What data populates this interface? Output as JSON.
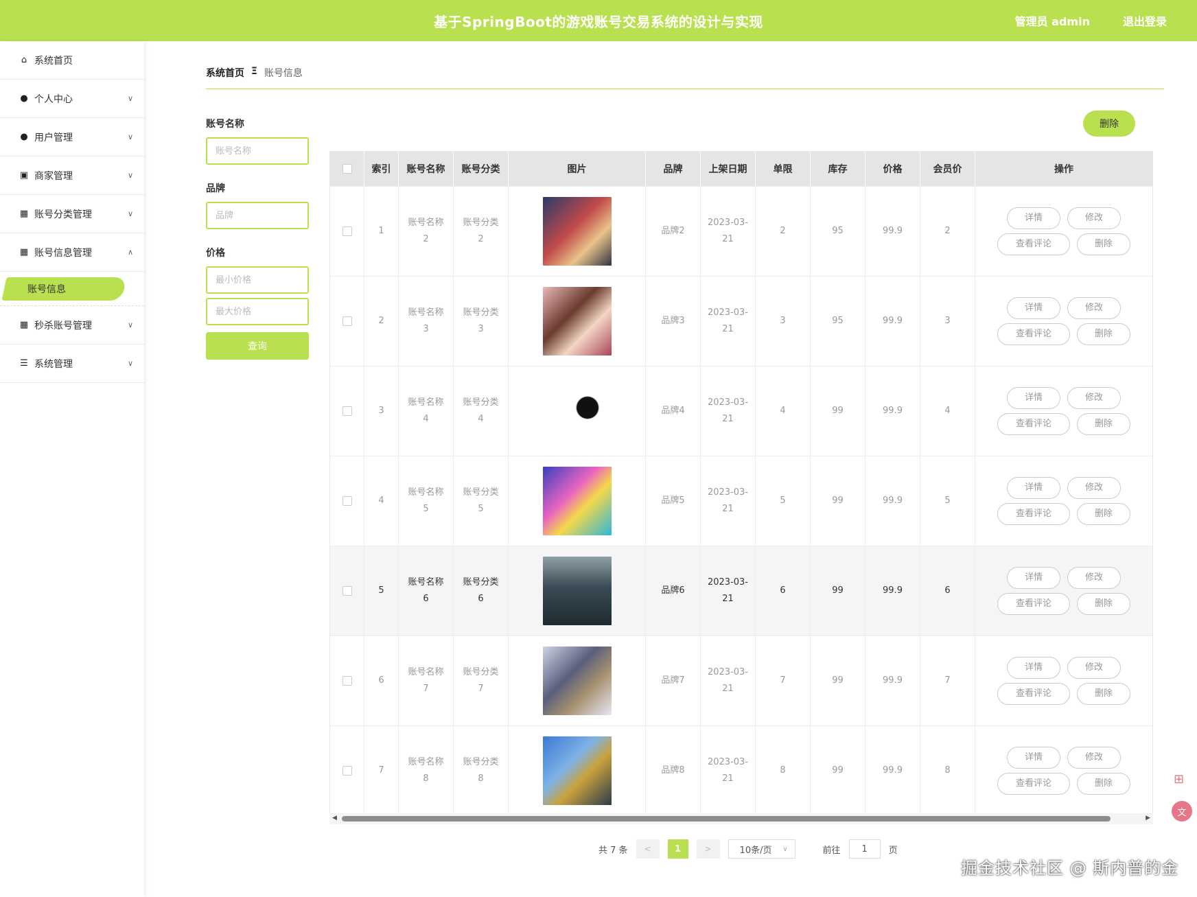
{
  "header": {
    "title": "基于SpringBoot的游戏账号交易系统的设计与实现",
    "user": "管理员 admin",
    "logout": "退出登录"
  },
  "sidebar": {
    "items": [
      {
        "label": "系统首页",
        "icon": "home-icon"
      },
      {
        "label": "个人中心",
        "icon": "user-icon"
      },
      {
        "label": "用户管理",
        "icon": "pin-icon"
      },
      {
        "label": "商家管理",
        "icon": "clipboard-icon"
      },
      {
        "label": "账号分类管理",
        "icon": "grid-icon"
      },
      {
        "label": "账号信息管理",
        "icon": "grid-icon"
      },
      {
        "label": "秒杀账号管理",
        "icon": "grid-icon"
      },
      {
        "label": "系统管理",
        "icon": "list-icon"
      }
    ],
    "active_sub": "账号信息"
  },
  "breadcrumb": {
    "home": "系统首页",
    "sep": "Ξ",
    "current": "账号信息"
  },
  "filters": {
    "name_label": "账号名称",
    "name_placeholder": "账号名称",
    "brand_label": "品牌",
    "brand_placeholder": "品牌",
    "price_label": "价格",
    "min_placeholder": "最小价格",
    "max_placeholder": "最大价格",
    "query": "查询"
  },
  "delete_top": "删除",
  "table": {
    "headers": [
      "索引",
      "账号名称",
      "账号分类",
      "图片",
      "品牌",
      "上架日期",
      "单限",
      "库存",
      "价格",
      "会员价",
      "操作"
    ],
    "rows": [
      {
        "idx": "1",
        "name": "账号名称\n2",
        "cat": "账号分类\n2",
        "brand": "品牌2",
        "date": "2023-03-\n21",
        "limit": "2",
        "stock": "95",
        "price": "99.9",
        "vip": "2"
      },
      {
        "idx": "2",
        "name": "账号名称\n3",
        "cat": "账号分类\n3",
        "brand": "品牌3",
        "date": "2023-03-\n21",
        "limit": "3",
        "stock": "95",
        "price": "99.9",
        "vip": "3"
      },
      {
        "idx": "3",
        "name": "账号名称\n4",
        "cat": "账号分类\n4",
        "brand": "品牌4",
        "date": "2023-03-\n21",
        "limit": "4",
        "stock": "99",
        "price": "99.9",
        "vip": "4"
      },
      {
        "idx": "4",
        "name": "账号名称\n5",
        "cat": "账号分类\n5",
        "brand": "品牌5",
        "date": "2023-03-\n21",
        "limit": "5",
        "stock": "99",
        "price": "99.9",
        "vip": "5"
      },
      {
        "idx": "5",
        "name": "账号名称\n6",
        "cat": "账号分类\n6",
        "brand": "品牌6",
        "date": "2023-03-\n21",
        "limit": "6",
        "stock": "99",
        "price": "99.9",
        "vip": "6"
      },
      {
        "idx": "6",
        "name": "账号名称\n7",
        "cat": "账号分类\n7",
        "brand": "品牌7",
        "date": "2023-03-\n21",
        "limit": "7",
        "stock": "99",
        "price": "99.9",
        "vip": "7"
      },
      {
        "idx": "7",
        "name": "账号名称\n8",
        "cat": "账号分类\n8",
        "brand": "品牌8",
        "date": "2023-03-\n21",
        "limit": "8",
        "stock": "99",
        "price": "99.9",
        "vip": "8"
      }
    ],
    "ops": {
      "detail": "详情",
      "edit": "修改",
      "comments": "查看评论",
      "delete": "删除"
    }
  },
  "pager": {
    "total": "共 7 条",
    "prev": "<",
    "page": "1",
    "next": ">",
    "size": "10条/页",
    "goto": "前往",
    "goto_value": "1",
    "page_unit": "页"
  },
  "watermark": "掘金技术社区 @ 斯内普的金",
  "colors": {
    "accent": "#b9e04e"
  }
}
